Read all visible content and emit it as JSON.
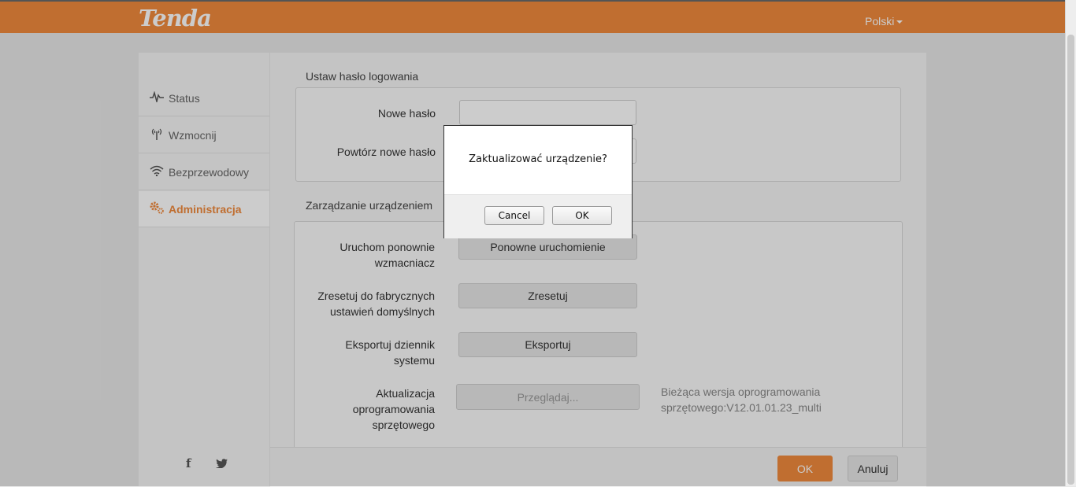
{
  "header": {
    "logo": "Tenda",
    "language": "Polski"
  },
  "sidebar": {
    "items": [
      {
        "icon": "pulse-icon",
        "label": "Status",
        "active": false
      },
      {
        "icon": "antenna-icon",
        "label": "Wzmocnij",
        "active": false
      },
      {
        "icon": "wifi-icon",
        "label": "Bezprzewodowy",
        "active": false
      },
      {
        "icon": "gear-icon",
        "label": "Administracja",
        "active": true
      }
    ],
    "social": {
      "facebook": "f",
      "twitter": "🐦"
    }
  },
  "password_section": {
    "title": "Ustaw hasło logowania",
    "new_password_label": "Nowe hasło",
    "new_password_value": "",
    "repeat_password_label": "Powtórz nowe hasło",
    "repeat_password_value": ""
  },
  "device_section": {
    "title": "Zarządzanie urządzeniem",
    "reboot_label": "Uruchom ponownie wzmacniacz",
    "reboot_button": "Ponowne uruchomienie",
    "reset_label": "Zresetuj do fabrycznych ustawień domyślnych",
    "reset_button": "Zresetuj",
    "export_label": "Eksportuj dziennik systemu",
    "export_button": "Eksportuj",
    "firmware_label": "Aktualizacja oprogramowania sprzętowego",
    "browse_button": "Przeglądaj...",
    "firmware_info": "Bieżąca wersja oprogramowania sprzętowego:V12.01.01.23_multi"
  },
  "footer": {
    "ok": "OK",
    "cancel": "Anuluj"
  },
  "dialog": {
    "message": "Zaktualizować urządzenie?",
    "cancel": "Cancel",
    "ok": "OK"
  },
  "colors": {
    "brand": "#f08a3c"
  }
}
